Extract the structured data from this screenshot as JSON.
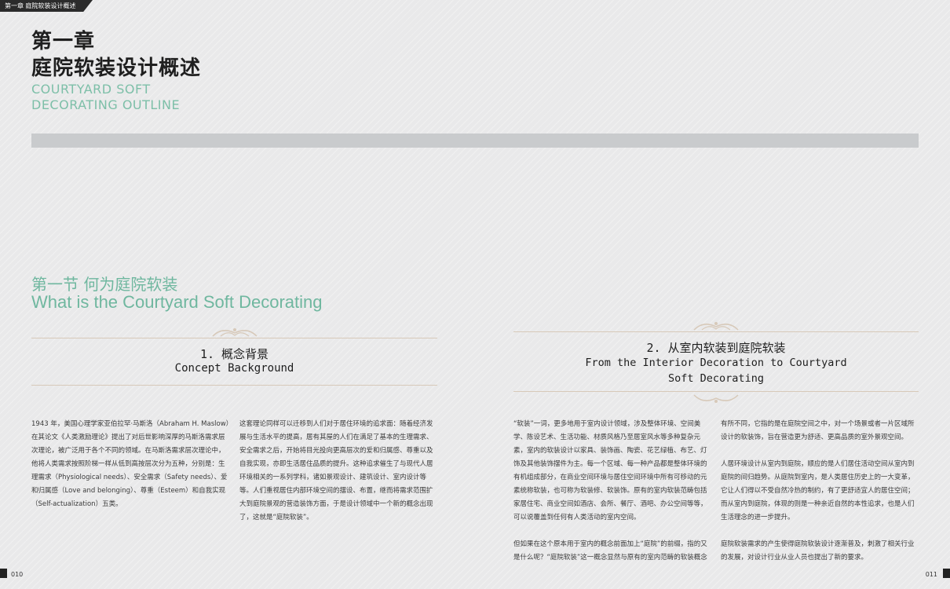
{
  "running_head": "第一章 庭院软装设计概述",
  "chapter": {
    "title_zh_line1": "第一章",
    "title_zh_line2": "庭院软装设计概述",
    "title_en_line1": "COURTYARD SOFT",
    "title_en_line2": "DECORATING OUTLINE"
  },
  "section": {
    "title_zh": "第一节 何为庭院软装",
    "title_en": "What is the Courtyard Soft Decorating"
  },
  "sub1": {
    "title_zh": "1. 概念背景",
    "title_en": "Concept Background"
  },
  "sub2": {
    "title_zh": "2. 从室内软装到庭院软装",
    "title_en_line1": "From the Interior Decoration to Courtyard",
    "title_en_line2": "Soft Decorating"
  },
  "columns": {
    "col1": [
      "1943 年，美国心理学家亚伯拉罕·马斯洛（Abraham H. Maslow）在其论文《人类激励理论》提出了对后世影响深厚的马斯洛需求层次理论，被广泛用于各个不同的领域。在马斯洛需求层次理论中，他将人类需求按照阶梯一样从低到高按层次分为五种，分别是：生理需求（Physiological needs）、安全需求（Safety needs）、爱和归属感（Love and belonging）、尊重（Esteem）和自我实现（Self-actualization）五类。"
    ],
    "col2": [
      "这套理论同样可以迁移到人们对于居住环境的追求面：随着经济发展与生活水平的提高，居有其屋的人们在满足了基本的生理需求、安全需求之后，开始将目光投向更高层次的爱和归属感、尊重以及自我实现，亦即生活居住品质的提升。这种追求催生了与现代人居环境相关的一系列学科，诸如景观设计、建筑设计、室内设计等等。人们重视居住内部环境空间的摆设、布置，继而将需求范围扩大到庭院景观的营造装饰方面，于是设计领域中一个新的概念出现了，这就是“庭院软装”。"
    ],
    "col3": [
      "“软装”一词，更多地用于室内设计领域，涉及整体环境、空间美学、陈设艺术、生活功能、材质风格乃至居室风水等多种复杂元素，室内的软装设计以家具、装饰画、陶瓷、花艺绿植、布艺、灯饰及其他装饰摆件为主。每一个区域、每一种产品都是整体环境的有机组成部分，在商业空间环境与居住空间环境中所有可移动的元素统称软装，也可称为软装修、软装饰。原有的室内软装范畴包括家居住宅、商业空间如酒店、会所、餐厅、酒吧、办公空间等等，可以说覆盖到任何有人类活动的室内空间。",
      "但如果在这个原本用于室内的概念前面加上“庭院”的前缀，指的又是什么呢？“庭院软装”这一概念显然与原有的室内范畴的软装概念"
    ],
    "col4": [
      "有所不同，它指的是在庭院空间之中，对一个场景或者一片区域所设计的软装饰，旨在营造更为舒适、更高品质的室外景观空间。",
      "人居环境设计从室内到庭院，顺应的是人们居住活动空间从室内到庭院的间归趋势。从庭院到室内，是人类居住历史上的一大变革，它让人们得以不受自然冷热的制约，有了更舒适宜人的居住空间；而从室内到庭院，体现的则是一种亲近自然的本性追求，也是人们生活理念的进一步提升。",
      "庭院软装需求的产生使得庭院软装设计逐渐普及，刺激了相关行业的发展，对设计行业从业人员也提出了新的要求。"
    ]
  },
  "page_numbers": {
    "left": "010",
    "right": "011"
  },
  "colors": {
    "accent_green": "#6fb79f",
    "band_gray": "#c9cbcd",
    "rule_beige": "#d7c9b9"
  },
  "icons": [
    "ornament-flourish-icon",
    "corner-mark-icon"
  ]
}
